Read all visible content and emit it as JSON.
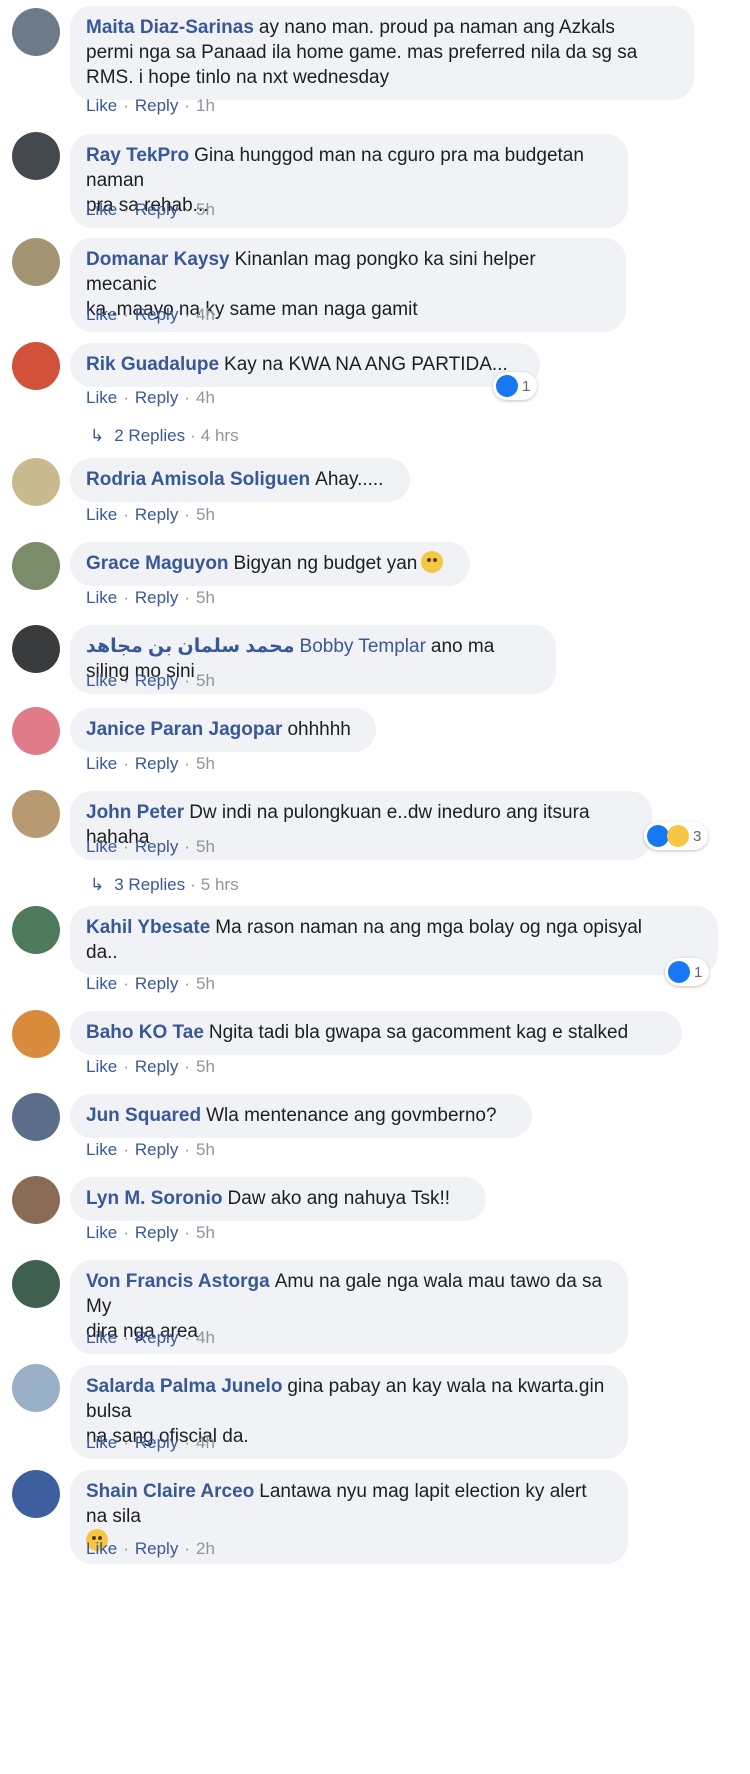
{
  "actions": {
    "like": "Like",
    "reply": "Reply",
    "dot": "·"
  },
  "comments": [
    {
      "author": "Maita Diaz-Sarinas",
      "lines": [
        "ay nano man. proud pa naman ang Azkals",
        "permi nga sa Panaad ila home game. mas preferred nila da sg sa",
        "RMS. i hope tinlo na nxt wednesday"
      ],
      "time": "1h",
      "avatar_color": "#6c7a89"
    },
    {
      "author": "Ray TekPro",
      "lines": [
        "Gina hunggod man na cguro pra ma budgetan naman",
        "pra sa rehab..."
      ],
      "time": "5h",
      "avatar_color": "#444950"
    },
    {
      "author": "Domanar Kaysy",
      "lines": [
        "Kinanlan mag pongko ka sini helper mecanic",
        "ka..maayo na ky same man naga gamit"
      ],
      "time": "4h",
      "avatar_color": "#a39574"
    },
    {
      "author": "Rik Guadalupe",
      "lines": [
        "Kay na KWA NA ANG PARTIDA..."
      ],
      "time": "4h",
      "avatar_color": "#d2513b",
      "reactions": "1",
      "replies_label": "2 Replies",
      "replies_time": "4 hrs"
    },
    {
      "author": "Rodria Amisola Soliguen",
      "lines": [
        "Ahay....."
      ],
      "time": "5h",
      "avatar_color": "#c9b98f"
    },
    {
      "author": "Grace Maguyon",
      "lines": [
        "Bigyan ng budget yan"
      ],
      "time": "5h",
      "avatar_color": "#7b8c6a"
    },
    {
      "author": "محمد سلمان بن مجاهد",
      "tagged": "Bobby Templar",
      "lines": [
        "ano ma siling mo sini"
      ],
      "time": "5h",
      "avatar_color": "#3a3b3c"
    },
    {
      "author": "Janice Paran Jagopar",
      "lines": [
        "ohhhhh"
      ],
      "time": "5h",
      "avatar_color": "#e07b8a"
    },
    {
      "author": "John Peter",
      "lines": [
        "Dw indi na pulongkuan e..dw ineduro ang itsura hahaha"
      ],
      "time": "5h",
      "avatar_color": "#b89a72",
      "reactions": "3",
      "replies_label": "3 Replies",
      "replies_time": "5 hrs"
    },
    {
      "author": "Kahil Ybesate",
      "lines": [
        "Ma rason naman na ang mga bolay og nga opisyal",
        "da.."
      ],
      "time": "5h",
      "avatar_color": "#4c7a5b",
      "reactions": "1"
    },
    {
      "author": "Baho KO Tae",
      "lines": [
        "Ngita tadi bla gwapa sa gacomment kag e stalked"
      ],
      "time": "5h",
      "avatar_color": "#d88b3a"
    },
    {
      "author": "Jun Squared",
      "lines": [
        "Wla mentenance ang govmberno?"
      ],
      "time": "5h",
      "avatar_color": "#5b6d8a"
    },
    {
      "author": "Lyn M. Soronio",
      "lines": [
        "Daw ako ang nahuya Tsk!!"
      ],
      "time": "5h",
      "avatar_color": "#8a6b55"
    },
    {
      "author": "Von Francis Astorga",
      "lines": [
        "Amu na gale nga wala mau tawo da sa My",
        "dira nga area"
      ],
      "time": "4h",
      "avatar_color": "#3f5f4f"
    },
    {
      "author": "Salarda Palma Junelo",
      "lines": [
        "gina pabay an kay wala na kwarta.gin bulsa",
        "na sang ofiscial da."
      ],
      "time": "4h",
      "avatar_color": "#9ab0c8"
    },
    {
      "author": "Shain Claire Arceo",
      "lines": [
        "Lantawa nyu mag lapit election ky alert na sila"
      ],
      "time": "2h",
      "avatar_color": "#3e5f9e"
    }
  ]
}
